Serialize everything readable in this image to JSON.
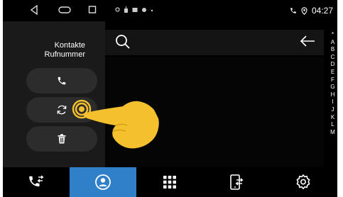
{
  "status_bar": {
    "time": "04:27",
    "nav": [
      "back-icon",
      "home-icon",
      "recents-icon"
    ],
    "notifications": [
      "location-dot-icon",
      "download-icon",
      "cast-icon",
      "record-icon",
      "small-dot-icon"
    ],
    "right_icons": [
      "phone-icon",
      "location-pin-icon"
    ]
  },
  "left_panel": {
    "title": "Kontakte\nRufnummer",
    "buttons": [
      {
        "icon": "phone-icon"
      },
      {
        "icon": "sync-icon"
      },
      {
        "icon": "trash-icon"
      }
    ]
  },
  "search": {
    "icons": [
      "search-icon",
      "back-arrow-icon"
    ]
  },
  "alphabet_index": [
    "*",
    "A",
    "B",
    "C",
    "D",
    "E",
    "F",
    "G",
    "H",
    "I",
    "J",
    "K",
    "L",
    "M"
  ],
  "bottom_nav": {
    "items": [
      {
        "icon": "phone-transfer-icon",
        "active": false
      },
      {
        "icon": "contacts-icon",
        "active": true
      },
      {
        "icon": "dialpad-icon",
        "active": false
      },
      {
        "icon": "device-transfer-icon",
        "active": false
      },
      {
        "icon": "settings-icon",
        "active": false
      }
    ],
    "active_color": "#2f80c8"
  },
  "colors": {
    "background": "#000000",
    "panel": "#1a1a1a",
    "button": "#2c2c2c",
    "tap_indicator": "#f5c02e"
  }
}
